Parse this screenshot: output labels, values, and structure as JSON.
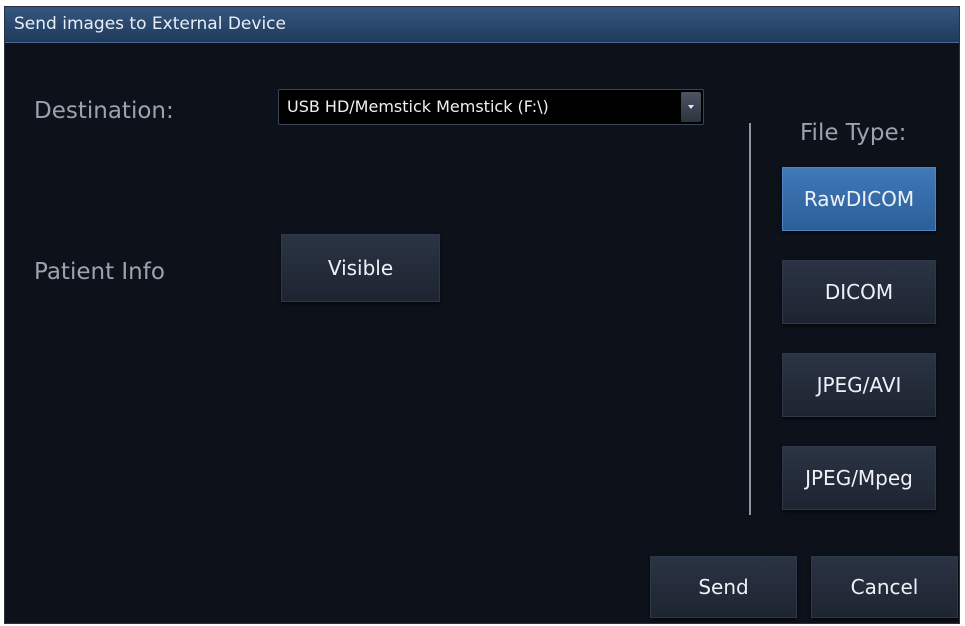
{
  "window": {
    "title": "Send images to External Device"
  },
  "destination": {
    "label": "Destination:",
    "selected": "USB HD/Memstick Memstick (F:\\)",
    "icon": "chevron-down-icon"
  },
  "patient_info": {
    "label": "Patient Info",
    "button_label": "Visible"
  },
  "file_type": {
    "label": "File Type:",
    "options": [
      {
        "label": "RawDICOM",
        "selected": true
      },
      {
        "label": "DICOM",
        "selected": false
      },
      {
        "label": "JPEG/AVI",
        "selected": false
      },
      {
        "label": "JPEG/Mpeg",
        "selected": false
      }
    ]
  },
  "actions": {
    "send_label": "Send",
    "cancel_label": "Cancel"
  },
  "colors": {
    "background": "#0d1119",
    "titlebar": "#2b4a6f",
    "accent_selected": "#3a72b0",
    "button": "#252d3a",
    "label_text": "#9aa3ae"
  }
}
